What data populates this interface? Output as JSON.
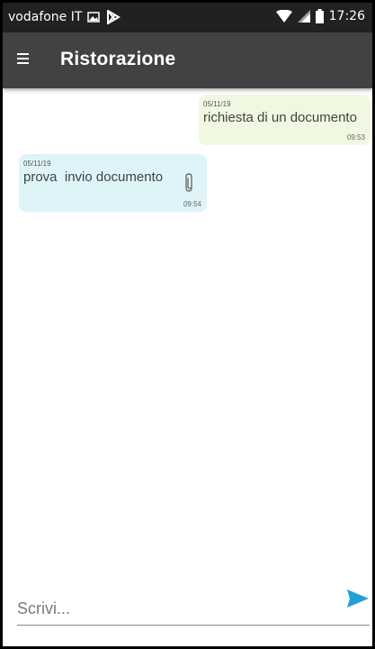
{
  "status_bar": {
    "carrier": "vodafone IT",
    "time": "17:26",
    "icons": [
      "image-notification-icon",
      "play-store-icon",
      "wifi-icon",
      "signal-icon",
      "battery-icon"
    ]
  },
  "app_bar": {
    "title": "Ristorazione",
    "menu_icon": "hamburger-menu-icon"
  },
  "messages": [
    {
      "direction": "sent",
      "date": "05/11/19",
      "text": "richiesta di un documento",
      "time": "09:53",
      "color": "#f1f8e1"
    },
    {
      "direction": "received",
      "date": "05/11/19",
      "text": "prova  invio documento",
      "time": "09:54",
      "attachment_icon": "paperclip-icon",
      "color": "#dff4f8"
    }
  ],
  "composer": {
    "placeholder": "Scrivi...",
    "value": "",
    "send_icon": "send-icon",
    "send_color": "#1ea0d8"
  }
}
